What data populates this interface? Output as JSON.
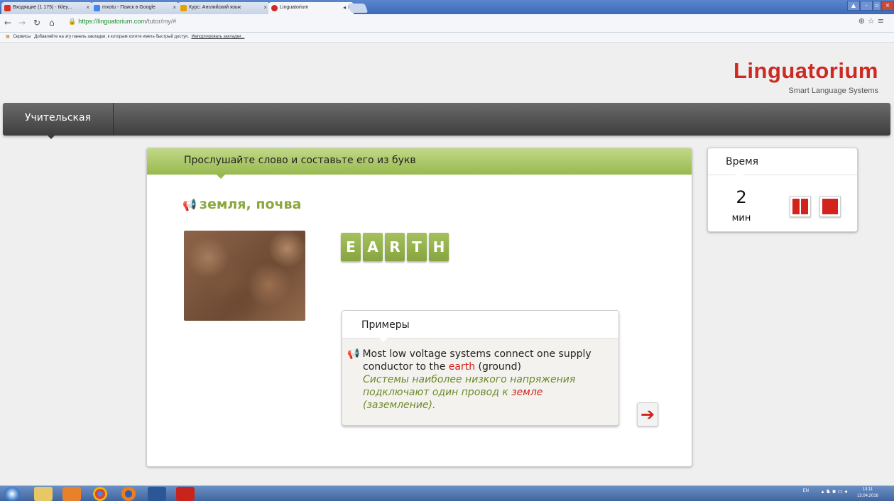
{
  "browser": {
    "tabs": [
      {
        "label": "Входящие (1 175) - tkley...",
        "icon_color": "#d93025"
      },
      {
        "label": "mxotu - Поиск в Google",
        "icon_color": "#4285f4"
      },
      {
        "label": "Курс: Английский язык",
        "icon_color": "#e2a400"
      },
      {
        "label": "Linguatorium",
        "icon_color": "#cc2a22"
      }
    ],
    "url_host": "https://linguatorium.com",
    "url_path": "/tutor/my/#",
    "bookmarks_apps": "Сервисы",
    "bookmarks_prompt": "Добавляйте на эту панель закладки, к которым хотите иметь быстрый доступ.",
    "bookmarks_import": "Импортировать закладки..."
  },
  "site": {
    "logo": "Linguatorium",
    "tagline": "Smart Language Systems",
    "nav_item": "Учительская"
  },
  "exercise": {
    "instruction": "Прослушайте слово и составьте его из букв",
    "word": "земля, почва",
    "letters": [
      "E",
      "A",
      "R",
      "T",
      "H"
    ],
    "examples_title": "Примеры",
    "example_en_before": "Most low voltage systems connect one supply conductor to the ",
    "example_en_hl": "earth",
    "example_en_after": " (ground)",
    "example_ru_before": "Системы наиболее низкого напряжения подключают один провод к ",
    "example_ru_hl": "земле",
    "example_ru_after": " (заземление)."
  },
  "timer": {
    "title": "Время",
    "value": "2",
    "unit": "мин"
  },
  "taskbar": {
    "lang": "EN",
    "time": "13:11",
    "date": "13.04.2016"
  },
  "colors": {
    "brand_red": "#cc2a22",
    "accent_green": "#98b94e"
  }
}
